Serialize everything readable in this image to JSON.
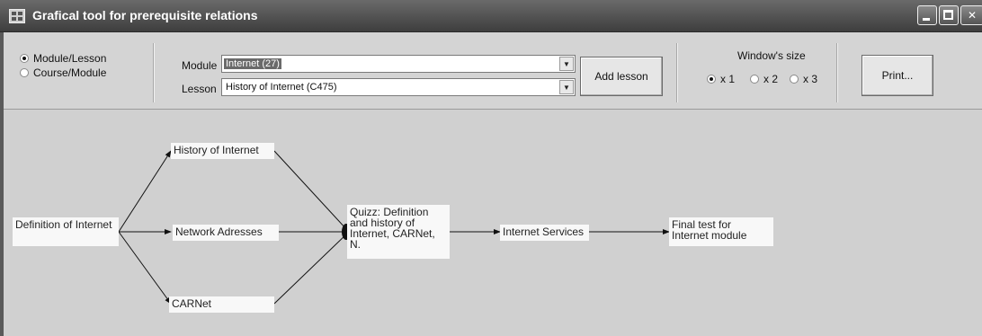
{
  "window": {
    "title": "Grafical tool for prerequisite relations"
  },
  "view_mode": {
    "options": [
      "Module/Lesson",
      "Course/Module"
    ],
    "selected": "Module/Lesson"
  },
  "module": {
    "label": "Module",
    "value": "Internet (27)"
  },
  "lesson": {
    "label": "Lesson",
    "value": "History of Internet (C475)"
  },
  "add_lesson_label": "Add lesson",
  "window_size": {
    "label": "Window's size",
    "options": [
      "x 1",
      "x 2",
      "x 3"
    ],
    "selected": "x 1"
  },
  "print_label": "Print...",
  "graph": {
    "nodes": {
      "definition": "Definition of Internet",
      "history": "History of Internet",
      "network": "Network Adresses",
      "carnet": "CARNet",
      "quiz": "Quizz: Definition and history of Internet, CARNet, N.",
      "services": "Internet Services",
      "final": "Final test for Internet module"
    },
    "edges": [
      [
        "definition",
        "history"
      ],
      [
        "definition",
        "network"
      ],
      [
        "definition",
        "carnet"
      ],
      [
        "history",
        "quiz"
      ],
      [
        "network",
        "quiz"
      ],
      [
        "carnet",
        "quiz"
      ],
      [
        "quiz",
        "services"
      ],
      [
        "services",
        "final"
      ]
    ]
  },
  "colors": {
    "titlebar": "#4a4a4a",
    "canvas": "#d0d0d0",
    "node": "#f8f8f8"
  }
}
